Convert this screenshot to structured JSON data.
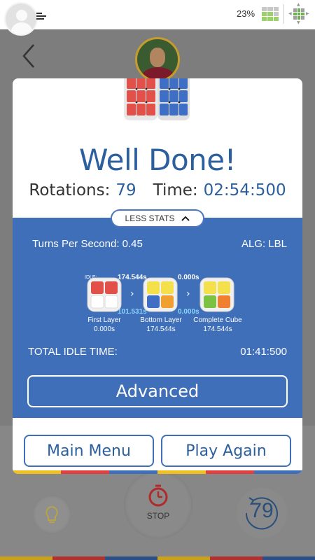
{
  "status_bar": {
    "battery_percent": "23%"
  },
  "modal": {
    "title": "Well Done!",
    "rotations_label": "Rotations:",
    "rotations_value": "79",
    "time_label": "Time:",
    "time_value": "02:54:500",
    "less_stats_label": "LESS STATS",
    "tps_label": "Turns Per Second: 0.45",
    "alg_label": "ALG: LBL",
    "stages": [
      {
        "name": "First Layer",
        "total": "0.000s",
        "move_time": "174.544s",
        "idle_tag": "IDLE:",
        "idle_time": "101.531s"
      },
      {
        "name": "Bottom Layer",
        "total": "174.544s",
        "move_time": "0.000s",
        "idle_time": "0.000s"
      },
      {
        "name": "Complete Cube",
        "total": "174.544s"
      }
    ],
    "total_idle_label": "TOTAL IDLE TIME:",
    "total_idle_value": "01:41:500",
    "advanced_label": "Advanced",
    "main_menu_label": "Main Menu",
    "play_again_label": "Play Again"
  },
  "game_controls": {
    "stop_label": "STOP",
    "rotation_counter": "79"
  },
  "colors": {
    "accent_blue": "#3f6fb9",
    "title_blue": "#2c5f9e",
    "idle_cyan": "#8ad4ff",
    "band": [
      "#f0c020",
      "#e04040",
      "#3f6fb9",
      "#f0c020",
      "#e04040",
      "#3f6fb9"
    ]
  },
  "icons": {
    "avatar": "user-avatar-icon",
    "menu": "menu-icon",
    "grid": "grid-icon",
    "cube_nav": "cube-nav-icon",
    "back": "chevron-left-icon",
    "bulb": "lightbulb-icon",
    "stop": "stopwatch-icon",
    "counter": "rotate-counter-icon",
    "caret": "chevron-up-icon"
  }
}
